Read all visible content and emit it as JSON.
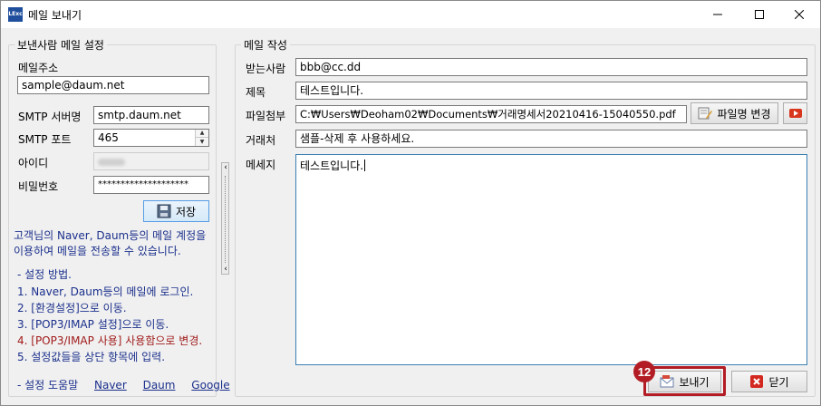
{
  "window": {
    "app_icon_text": "LExc",
    "title": "메일 보내기"
  },
  "sender": {
    "group_title": "보낸사람 메일 설정",
    "email_label": "메일주소",
    "email_value": "sample@daum.net",
    "smtp_server_label": "SMTP 서버명",
    "smtp_server_value": "smtp.daum.net",
    "smtp_port_label": "SMTP 포트",
    "smtp_port_value": "465",
    "id_label": "아이디",
    "password_label": "비밀번호",
    "password_value": "********************",
    "save_button": "저장",
    "info_line1": "고객님의 Naver, Daum등의 메일 계정을",
    "info_line2": "이용하여 메일을 전송할 수 있습니다.",
    "steps_title": "- 설정 방법.",
    "step1": "1. Naver, Daum등의 메일에 로그인.",
    "step2": "2. [환경설정]으로 이동.",
    "step3": "3. [POP3/IMAP 설정]으로 이동.",
    "step4": "4. [POP3/IMAP 사용] 사용함으로 변경.",
    "step5": "5. 설정값들을 상단 항목에 입력.",
    "help_label": "- 설정 도움말",
    "help_links": [
      "Naver",
      "Daum",
      "Google"
    ],
    "colors": {
      "info": "#1a2f8c",
      "warning_step": "#a11a1a"
    }
  },
  "compose": {
    "group_title": "메일 작성",
    "to_label": "받는사람",
    "to_value": "bbb@cc.dd",
    "subject_label": "제목",
    "subject_value": "테스트입니다.",
    "attach_label": "파일첨부",
    "attach_value": "C:₩Users₩Deoham02₩Documents₩거래명세서20210416-15040550.pdf",
    "rename_button": "파일명 변경",
    "client_label": "거래처",
    "client_value": "샘플-삭제 후 사용하세요.",
    "message_label": "메세지",
    "message_value": "테스트입니다."
  },
  "footer": {
    "send_button": "보내기",
    "close_button": "닫기",
    "badge": "12",
    "badge_color": "#b31c24"
  }
}
